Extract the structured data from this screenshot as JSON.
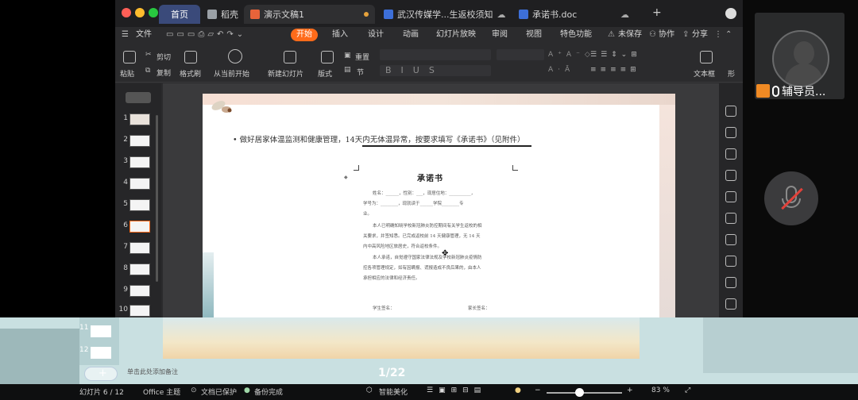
{
  "tabs": {
    "home": "首页",
    "docer": "稻壳",
    "presentation": "演示文稿1",
    "notice": "武汉传媒学...生返校须知",
    "pledge": "承诺书.doc",
    "add": "+"
  },
  "menu": {
    "file": "文件",
    "start": "开始",
    "insert": "插入",
    "design": "设计",
    "animation": "动画",
    "slideshow": "幻灯片放映",
    "review": "审阅",
    "view": "视图",
    "special": "特色功能",
    "unsaved": "未保存",
    "collab": "协作",
    "share": "分享"
  },
  "toolbar": {
    "paste": "粘贴",
    "cut": "剪切",
    "copy": "复制",
    "format_painter": "格式刷",
    "play_from_current": "从当前开始",
    "new_slide": "新建幻灯片",
    "layout": "版式",
    "reset": "重置",
    "section": "节",
    "textbox": "文本框",
    "shape": "形"
  },
  "thumbnails": [
    "1",
    "2",
    "3",
    "4",
    "5",
    "6",
    "7",
    "8",
    "9",
    "10"
  ],
  "slide": {
    "bullet": "做好居家体温监测和健康管理，14天内无体温异常，按要求填写《承诺书》（见附件）",
    "doc_title": "承诺书",
    "doc_lines": [
      "姓名：______，性别：___，现居住地：__________，",
      "学号为：________，现就读于______学院________专",
      "业。",
      "本人已明确知晓学校新冠肺炎防控期间有关学生返校的相",
      "关要求，并签知悉。已完成返校前 14 天健康管理，无 14 天",
      "内中高风险地区旅居史，符合返校条件。",
      "本人承诺，自觉遵守国家法律法规及学校新冠肺炎疫情防",
      "控各项管理规定，如有因瞒报、谎报造成不良后果的，由本人",
      "承担相应的法律和经济责任。"
    ],
    "student_sign": "学生签名：",
    "parent_sign": "家长签名："
  },
  "meeting": {
    "speaker_name": "辅导员..."
  },
  "bottom": {
    "thumb_11": "11",
    "thumb_12": "12",
    "add_label": "+",
    "notes_placeholder": "单击此处添加备注",
    "page_counter": "1/22"
  },
  "status": {
    "slide_info": "幻灯片 6 / 12",
    "theme": "Office 主题",
    "doc_protect": "文档已保护",
    "backup": "备份完成",
    "beautify": "智能美化",
    "zoom": "83 %"
  },
  "colors": {
    "accent": "#ff6b1a",
    "home_tab": "#3a4a7a",
    "mute_slash": "#e0413a",
    "host_badge": "#f08a24"
  }
}
